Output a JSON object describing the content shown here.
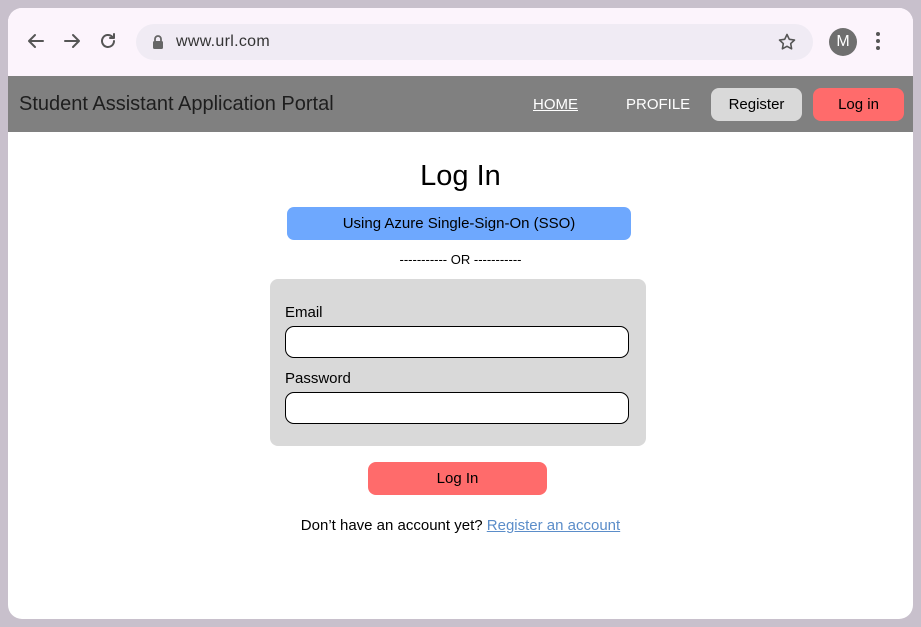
{
  "browser": {
    "url": "www.url.com",
    "profile_initial": "M",
    "icons": [
      "back-arrow-icon",
      "forward-arrow-icon",
      "reload-icon",
      "lock-icon",
      "star-icon",
      "kebab-menu-icon"
    ]
  },
  "header": {
    "title": "Student Assistant Application Portal",
    "nav": {
      "home": "HOME",
      "profile": "PROFILE"
    },
    "register_label": "Register",
    "login_label": "Log in",
    "colors": {
      "bar": "#808080",
      "register": "#d9d9d9",
      "login": "#ff6b6b"
    }
  },
  "main": {
    "title": "Log In",
    "sso_label": "Using Azure Single-Sign-On (SSO)",
    "separator": "----------- OR -----------",
    "form": {
      "email_label": "Email",
      "email_value": "",
      "password_label": "Password",
      "password_value": ""
    },
    "submit_label": "Log In",
    "register_prompt": "Don’t have an account yet? ",
    "register_link": "Register an account",
    "colors": {
      "sso": "#6ea8fe",
      "submit": "#ff6b6b",
      "form_bg": "#d9d9d9"
    }
  }
}
